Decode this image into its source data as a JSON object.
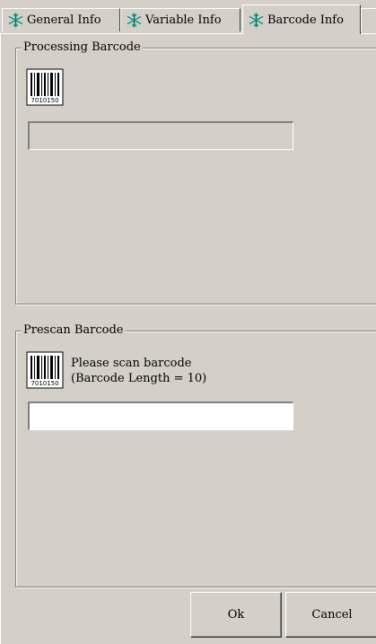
{
  "tabs": [
    {
      "label": "General Info",
      "icon": "snowflake-icon"
    },
    {
      "label": "Variable Info",
      "icon": "snowflake-icon"
    },
    {
      "label": "Barcode Info",
      "icon": "snowflake-icon",
      "selected": true
    }
  ],
  "processing": {
    "title": "Processing Barcode",
    "icon": "barcode-icon",
    "barcode_value": "7010150",
    "field_value": ""
  },
  "prescan": {
    "title": "Prescan Barcode",
    "icon": "barcode-icon",
    "barcode_value": "7010150",
    "prompt_line1": "Please scan barcode",
    "prompt_line2": "(Barcode Length = 10)",
    "field_value": ""
  },
  "buttons": {
    "ok": "Ok",
    "cancel": "Cancel"
  },
  "colors": {
    "face": "#d4d0c8",
    "shadow": "#808080",
    "highlight": "#ffffff",
    "icon_teal": "#1a9c8e"
  }
}
